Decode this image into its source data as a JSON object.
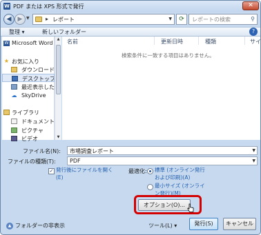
{
  "window": {
    "title": "PDF または XPS 形式で発行",
    "app_icon": "W",
    "close_glyph": "✕"
  },
  "address_bar": {
    "separator": "▸",
    "path": "レポート"
  },
  "search": {
    "placeholder": "レポートの検索"
  },
  "toolbar": {
    "organize": "整理 ▾",
    "new_folder": "新しいフォルダー",
    "help": "?"
  },
  "sidebar": {
    "items": [
      {
        "label": "Microsoft Word",
        "icon": "word-icon"
      },
      {
        "label": "お気に入り",
        "icon": "star-icon"
      },
      {
        "label": "ダウンロード",
        "icon": "download-folder-icon"
      },
      {
        "label": "デスクトップ",
        "icon": "desktop-icon",
        "selected": true
      },
      {
        "label": "最近表示した場所",
        "icon": "recent-places-icon"
      },
      {
        "label": "SkyDrive",
        "icon": "skydrive-icon"
      },
      {
        "label": "ライブラリ",
        "icon": "library-icon"
      },
      {
        "label": "ドキュメント",
        "icon": "documents-icon"
      },
      {
        "label": "ピクチャ",
        "icon": "pictures-icon"
      },
      {
        "label": "ビデオ",
        "icon": "video-icon"
      }
    ]
  },
  "file_list": {
    "columns": [
      "名前",
      "更新日時",
      "種類",
      "サイ"
    ],
    "empty_message": "検索条件に一致する項目はありません。"
  },
  "form": {
    "filename_label": "ファイル名(N):",
    "filename_value": "市場調査レポート",
    "filetype_label": "ファイルの種類(T):",
    "filetype_value": "PDF"
  },
  "options": {
    "open_after_publish_line1": "発行後にファイルを開く",
    "open_after_publish_line2": "(E)",
    "open_after_publish_checked": true,
    "optimize_label": "最適化:",
    "standard_line1": "標準 (オンライン発行",
    "standard_line2": "および印刷)(A)",
    "minimum_line1": "最小サイズ (オンライ",
    "minimum_line2": "ン発行)(M)",
    "selected": "standard",
    "options_button": "オプション(O)..."
  },
  "bottom": {
    "hide_folders": "フォルダーの非表示",
    "tools": "ツール(L) ▾",
    "publish": "発行(S)",
    "cancel": "キャンセル"
  },
  "colors": {
    "highlight": "#d40000",
    "link_text": "#2360b0"
  }
}
